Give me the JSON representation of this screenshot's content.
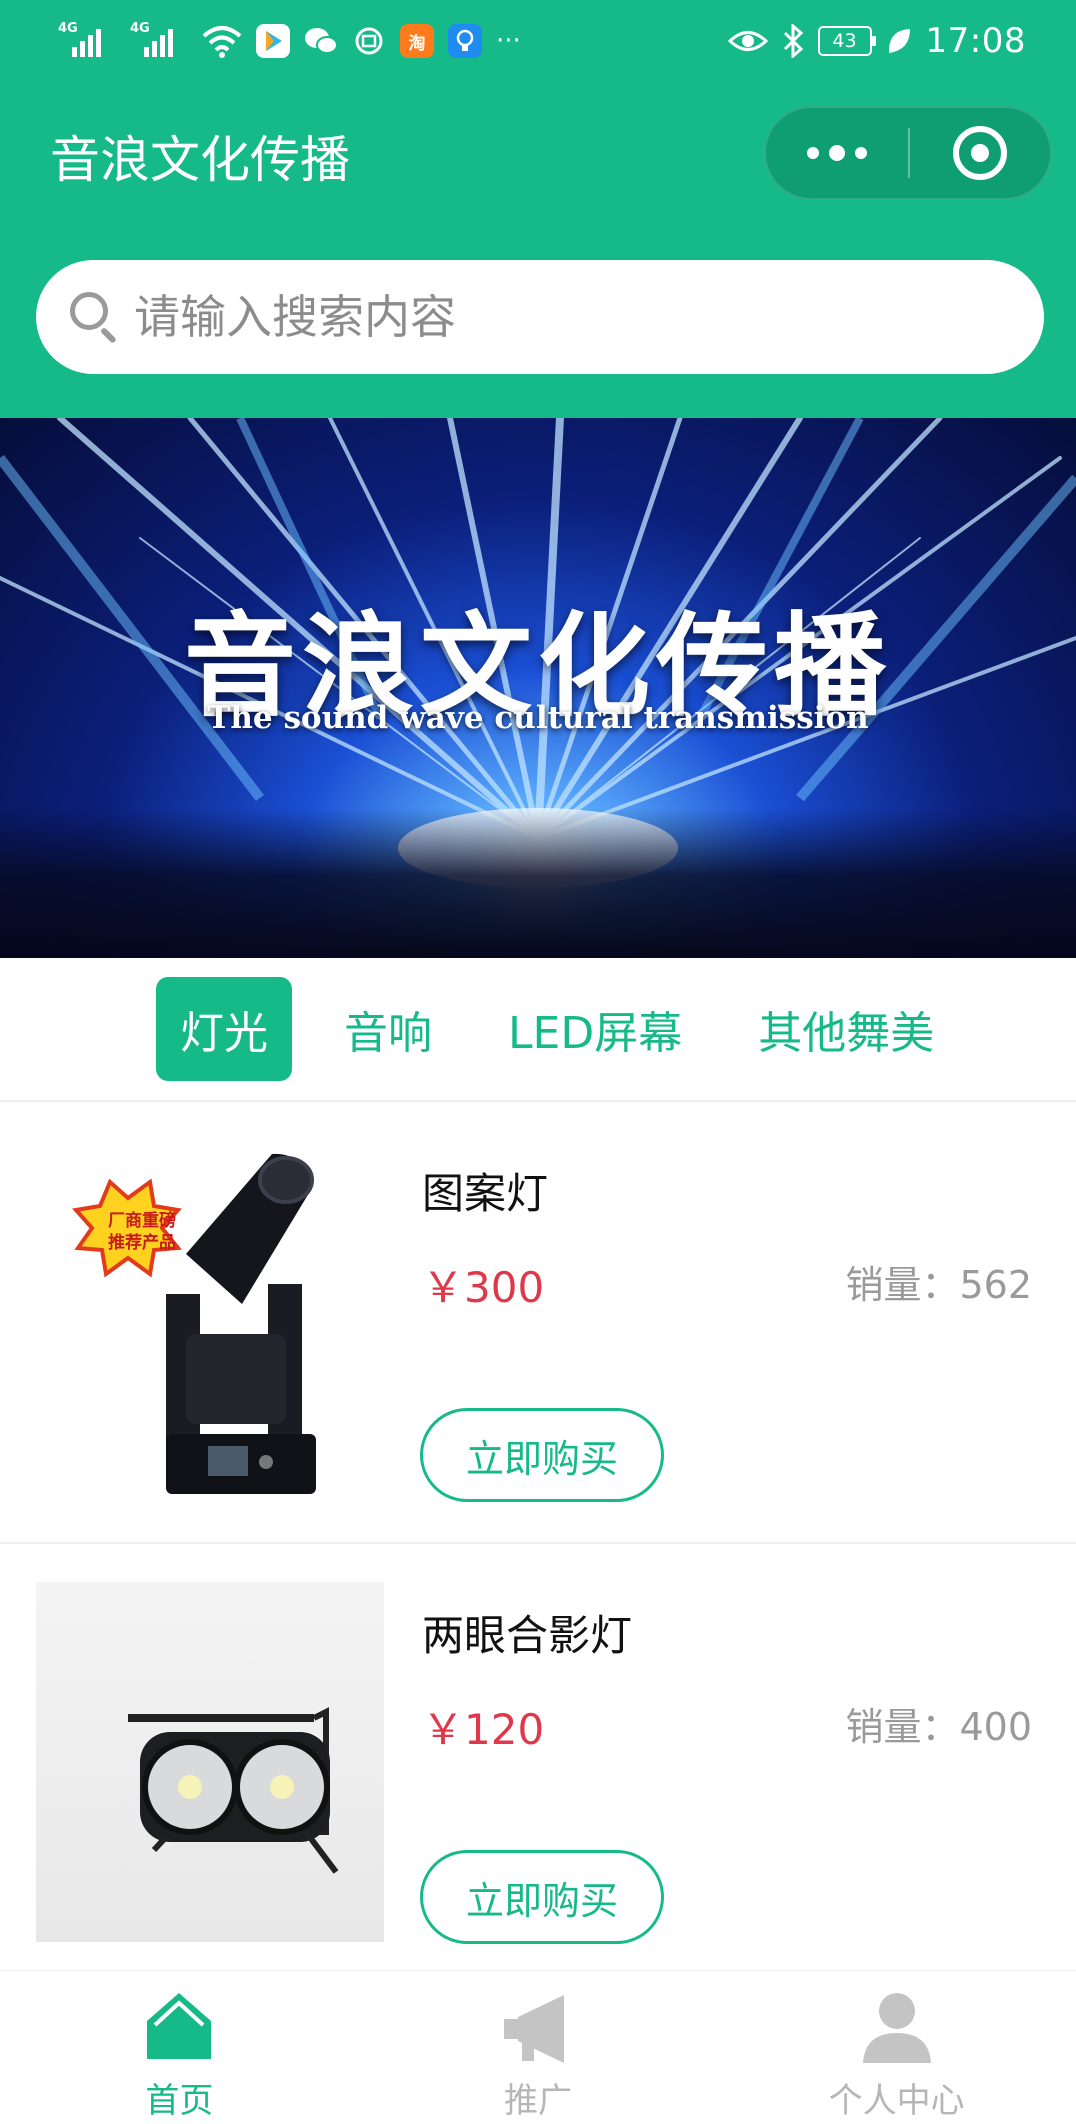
{
  "status_bar": {
    "net1": "4G",
    "net2": "4G",
    "more": "···",
    "battery": "43",
    "time": "17:08",
    "app_icons": [
      "video-app-icon",
      "wechat-icon",
      "app-icon",
      "taobao-icon",
      "bulb-app-icon"
    ]
  },
  "header": {
    "title": "音浪文化传播",
    "accent_color": "#16ba88"
  },
  "search": {
    "placeholder": "请输入搜索内容"
  },
  "banner": {
    "title": "音浪文化传播",
    "subtitle": "The sound wave cultural transmission"
  },
  "categories": [
    {
      "label": "灯光",
      "active": true
    },
    {
      "label": "音响",
      "active": false
    },
    {
      "label": "LED屏幕",
      "active": false
    },
    {
      "label": "其他舞美",
      "active": false
    }
  ],
  "products": [
    {
      "name": "图案灯",
      "price": "￥300",
      "sales": "销量：562",
      "buy_label": "立即购买",
      "badge": [
        "厂商重磅",
        "推荐产品"
      ]
    },
    {
      "name": "两眼合影灯",
      "price": "￥120",
      "sales": "销量：400",
      "buy_label": "立即购买"
    }
  ],
  "tabbar": [
    {
      "label": "首页",
      "active": true
    },
    {
      "label": "推广",
      "active": false
    },
    {
      "label": "个人中心",
      "active": false
    }
  ]
}
